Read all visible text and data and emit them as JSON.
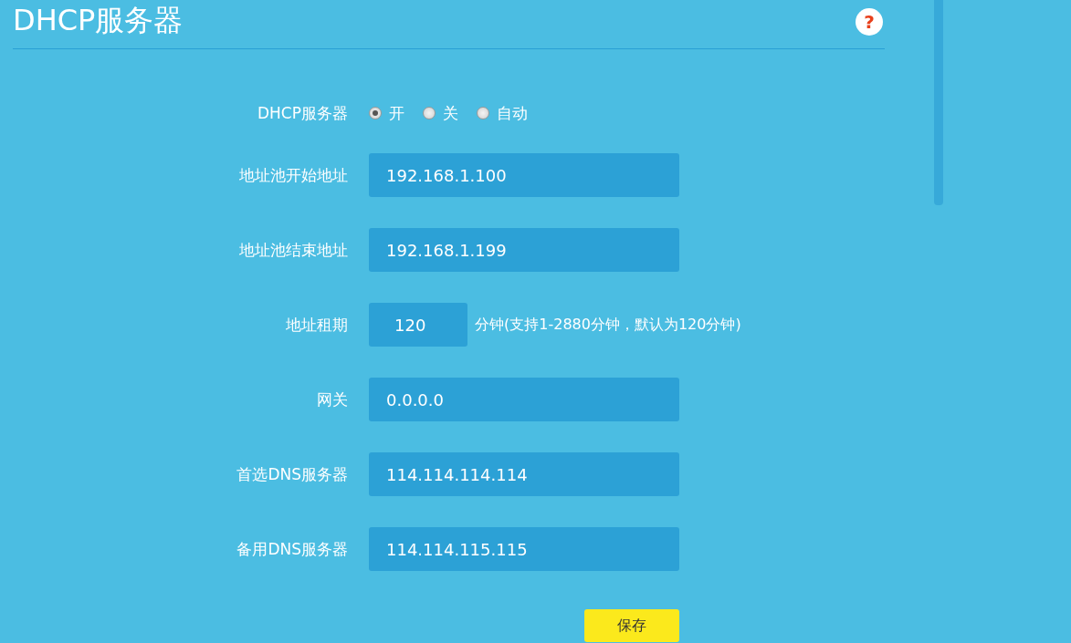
{
  "title": "DHCP服务器",
  "help": {
    "glyph": "?"
  },
  "dhcp_server": {
    "label": "DHCP服务器",
    "options": [
      {
        "label": "开",
        "selected": true
      },
      {
        "label": "关",
        "selected": false
      },
      {
        "label": "自动",
        "selected": false
      }
    ]
  },
  "fields": [
    {
      "kind": "wide",
      "label": "地址池开始地址",
      "value": "192.168.1.100"
    },
    {
      "kind": "wide",
      "label": "地址池结束地址",
      "value": "192.168.1.199"
    },
    {
      "kind": "short",
      "label": "地址租期",
      "value": "120",
      "hint": "分钟(支持1-2880分钟，默认为120分钟)"
    },
    {
      "kind": "wide",
      "label": "网关",
      "value": "0.0.0.0"
    },
    {
      "kind": "wide",
      "label": "首选DNS服务器",
      "value": "114.114.114.114"
    },
    {
      "kind": "wide",
      "label": "备用DNS服务器",
      "value": "114.114.115.115"
    }
  ],
  "save_button": "保存"
}
